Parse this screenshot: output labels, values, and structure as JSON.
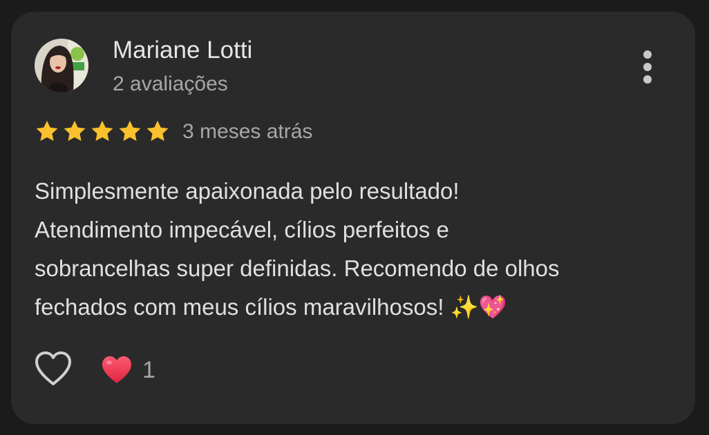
{
  "review": {
    "reviewer_name": "Mariane Lotti",
    "review_count": "2 avaliações",
    "rating": 5,
    "rating_max": 5,
    "time_ago": "3 meses atrás",
    "text_lines": [
      "Simplesmente apaixonada pelo resultado!",
      "Atendimento impecável, cílios perfeitos e",
      "sobrancelhas super definidas. Recomendo de olhos",
      "fechados com meus cílios maravilhosos! ✨💖"
    ],
    "reaction_count": "1"
  },
  "colors": {
    "background": "#1b1b1b",
    "card": "#2a2a2b",
    "star": "#fbc02d",
    "reaction_heart": "#e8344f"
  },
  "icons": {
    "more": "more-vert-icon",
    "star": "star-icon",
    "like": "heart-outline-icon",
    "reaction": "red-heart-icon"
  }
}
